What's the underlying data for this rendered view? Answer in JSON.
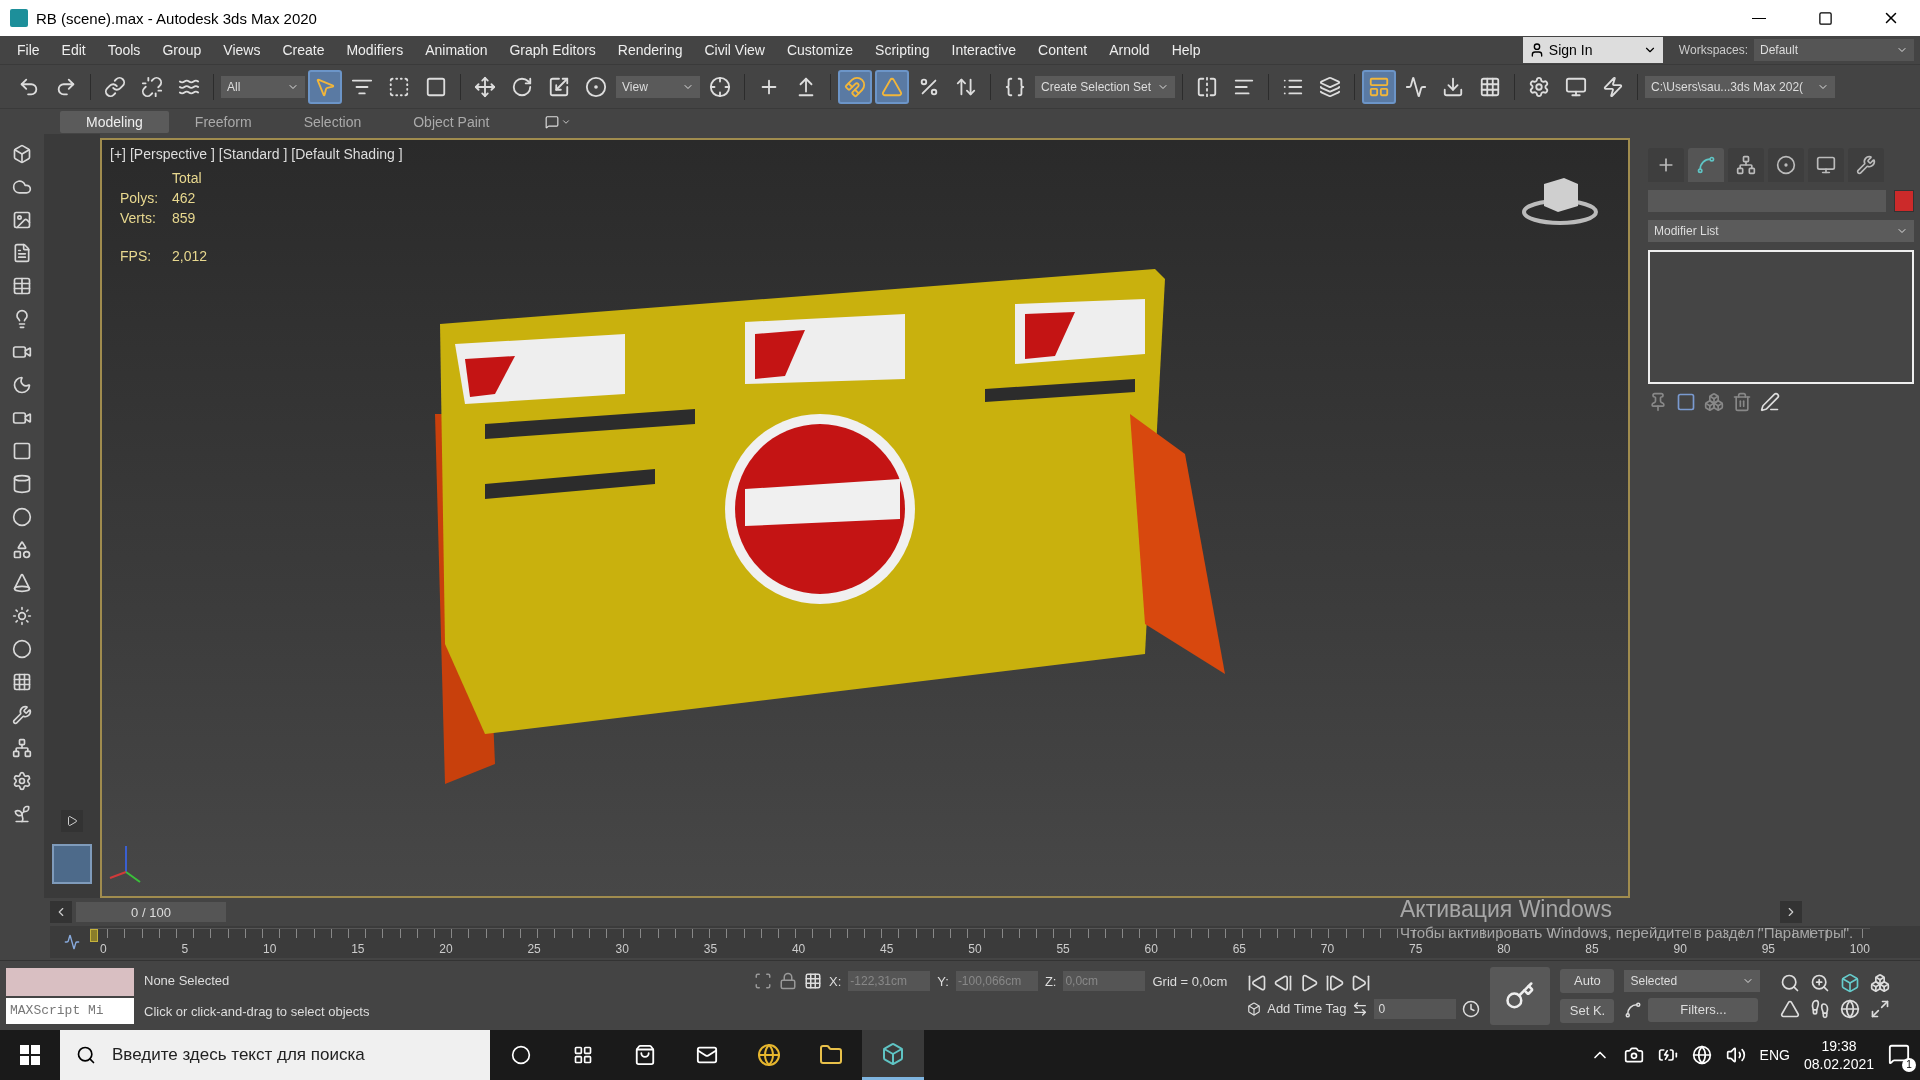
{
  "window": {
    "title": "RB (scene).max - Autodesk 3ds Max 2020"
  },
  "menu": [
    "File",
    "Edit",
    "Tools",
    "Group",
    "Views",
    "Create",
    "Modifiers",
    "Animation",
    "Graph Editors",
    "Rendering",
    "Civil View",
    "Customize",
    "Scripting",
    "Interactive",
    "Content",
    "Arnold",
    "Help"
  ],
  "account": {
    "label": "Sign In"
  },
  "workspaces": {
    "label": "Workspaces:",
    "value": "Default"
  },
  "toolbar": {
    "selection_filter": "All",
    "reference_coord": "View",
    "selection_set": "Create Selection Set",
    "project_path": "C:\\Users\\sau...3ds Max 202(",
    "buttons": [
      {
        "selected": false
      },
      {
        "selected": false
      },
      {
        "selected": false
      },
      {
        "selected": false
      },
      {
        "selected": false
      },
      {
        "selected": true
      },
      {
        "selected": false
      },
      {
        "selected": false
      },
      {
        "selected": false
      },
      {
        "selected": false
      },
      {
        "selected": false
      },
      {
        "selected": false
      },
      {
        "selected": false
      },
      {
        "selected": false
      },
      {
        "selected": false
      },
      {
        "selected": false
      },
      {
        "selected": true
      },
      {
        "selected": true
      },
      {
        "selected": false
      },
      {
        "selected": false
      },
      {
        "selected": false
      },
      {
        "selected": false
      },
      {
        "selected": false
      },
      {
        "selected": false
      },
      {
        "selected": false
      },
      {
        "selected": true
      },
      {
        "selected": false
      },
      {
        "selected": false
      },
      {
        "selected": false
      },
      {
        "selected": false
      },
      {
        "selected": false
      },
      {
        "selected": false
      }
    ]
  },
  "ribbon_tabs": [
    {
      "label": "Modeling",
      "selected": true
    },
    {
      "label": "Freeform",
      "selected": false
    },
    {
      "label": "Selection",
      "selected": false
    },
    {
      "label": "Object Paint",
      "selected": false
    }
  ],
  "viewport": {
    "labels": [
      "[+]",
      "[Perspective ]",
      "[Standard ]",
      "[Default Shading ]"
    ],
    "stats": {
      "header": "Total",
      "rows": [
        {
          "label": "Polys:",
          "value": "462"
        },
        {
          "label": "Verts:",
          "value": "859"
        }
      ],
      "fps_label": "FPS:",
      "fps": "2,012"
    }
  },
  "command_panel": {
    "tabs": [
      {
        "selected": false
      },
      {
        "selected": true
      },
      {
        "selected": false
      },
      {
        "selected": false
      },
      {
        "selected": false
      },
      {
        "selected": false
      }
    ],
    "modifier_list": "Modifier List"
  },
  "timeline": {
    "frame": "0 / 100",
    "ticks": [
      "0",
      "5",
      "10",
      "15",
      "20",
      "25",
      "30",
      "35",
      "40",
      "45",
      "50",
      "55",
      "60",
      "65",
      "70",
      "75",
      "80",
      "85",
      "90",
      "95",
      "100"
    ]
  },
  "status": {
    "maxscript": "MAXScript Mi",
    "selection": "None Selected",
    "prompt": "Click or click-and-drag to select objects",
    "x_label": "X:",
    "x": "-122,31cm",
    "y_label": "Y:",
    "y": "-100,066cm",
    "z_label": "Z:",
    "z": "0,0cm",
    "grid": "Grid = 0,0cm",
    "time_tag": "Add Time Tag",
    "frame_value": "0",
    "auto": "Auto",
    "set_key": "Set K.",
    "key_filter": "Selected",
    "filters": "Filters..."
  },
  "activation": {
    "title": "Активация Windows",
    "text": "Чтобы активировать Windows, перейдите в раздел \"Параметры\"."
  },
  "taskbar": {
    "search_placeholder": "Введите здесь текст для поиска",
    "language": "ENG",
    "time": "19:38",
    "date": "08.02.2021",
    "notifications": "1"
  }
}
